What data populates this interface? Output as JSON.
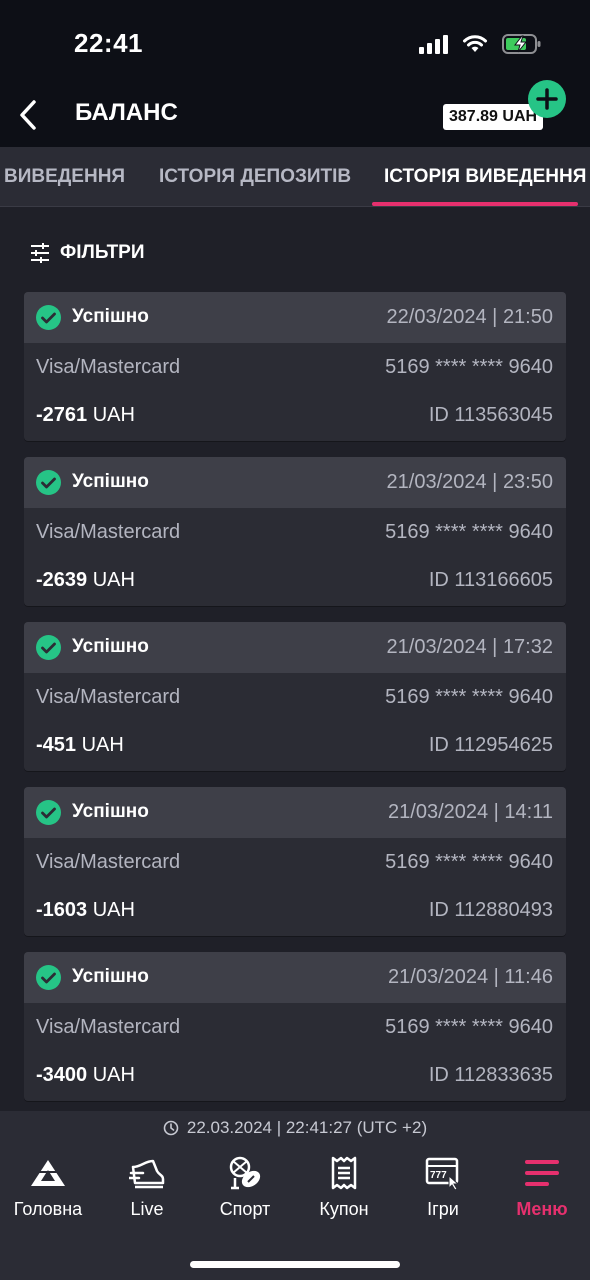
{
  "status_bar": {
    "time": "22:41"
  },
  "header": {
    "title": "БАЛАНС",
    "balance": "387.89 UAH"
  },
  "tabs": [
    {
      "label": "ВИВЕДЕННЯ"
    },
    {
      "label": "ІСТОРІЯ ДЕПОЗИТІВ"
    },
    {
      "label": "ІСТОРІЯ ВИВЕДЕННЯ"
    }
  ],
  "filters": {
    "label": "ФІЛЬТРИ"
  },
  "transactions": [
    {
      "status": "Успішно",
      "date": "22/03/2024 | 21:50",
      "method": "Visa/Mastercard",
      "card": "5169 **** **** 9640",
      "amount": "-2761",
      "currency": "UAH",
      "id": "ID 113563045"
    },
    {
      "status": "Успішно",
      "date": "21/03/2024 | 23:50",
      "method": "Visa/Mastercard",
      "card": "5169 **** **** 9640",
      "amount": "-2639",
      "currency": "UAH",
      "id": "ID 113166605"
    },
    {
      "status": "Успішно",
      "date": "21/03/2024 | 17:32",
      "method": "Visa/Mastercard",
      "card": "5169 **** **** 9640",
      "amount": "-451",
      "currency": "UAH",
      "id": "ID 112954625"
    },
    {
      "status": "Успішно",
      "date": "21/03/2024 | 14:11",
      "method": "Visa/Mastercard",
      "card": "5169 **** **** 9640",
      "amount": "-1603",
      "currency": "UAH",
      "id": "ID 112880493"
    },
    {
      "status": "Успішно",
      "date": "21/03/2024 | 11:46",
      "method": "Visa/Mastercard",
      "card": "5169 **** **** 9640",
      "amount": "-3400",
      "currency": "UAH",
      "id": "ID 112833635"
    }
  ],
  "footer": {
    "timestamp": "22.03.2024 | 22:41:27 (UTC +2)"
  },
  "nav": [
    {
      "label": "Головна",
      "icon": "home-icon"
    },
    {
      "label": "Live",
      "icon": "live-icon"
    },
    {
      "label": "Спорт",
      "icon": "sport-icon"
    },
    {
      "label": "Купон",
      "icon": "coupon-icon"
    },
    {
      "label": "Ігри",
      "icon": "games-icon"
    },
    {
      "label": "Меню",
      "icon": "menu-icon"
    }
  ],
  "colors": {
    "accent": "#e6306e",
    "success": "#26c486",
    "background": "#1f2028",
    "card": "#2b2c34",
    "card_header": "#3e3f48"
  }
}
